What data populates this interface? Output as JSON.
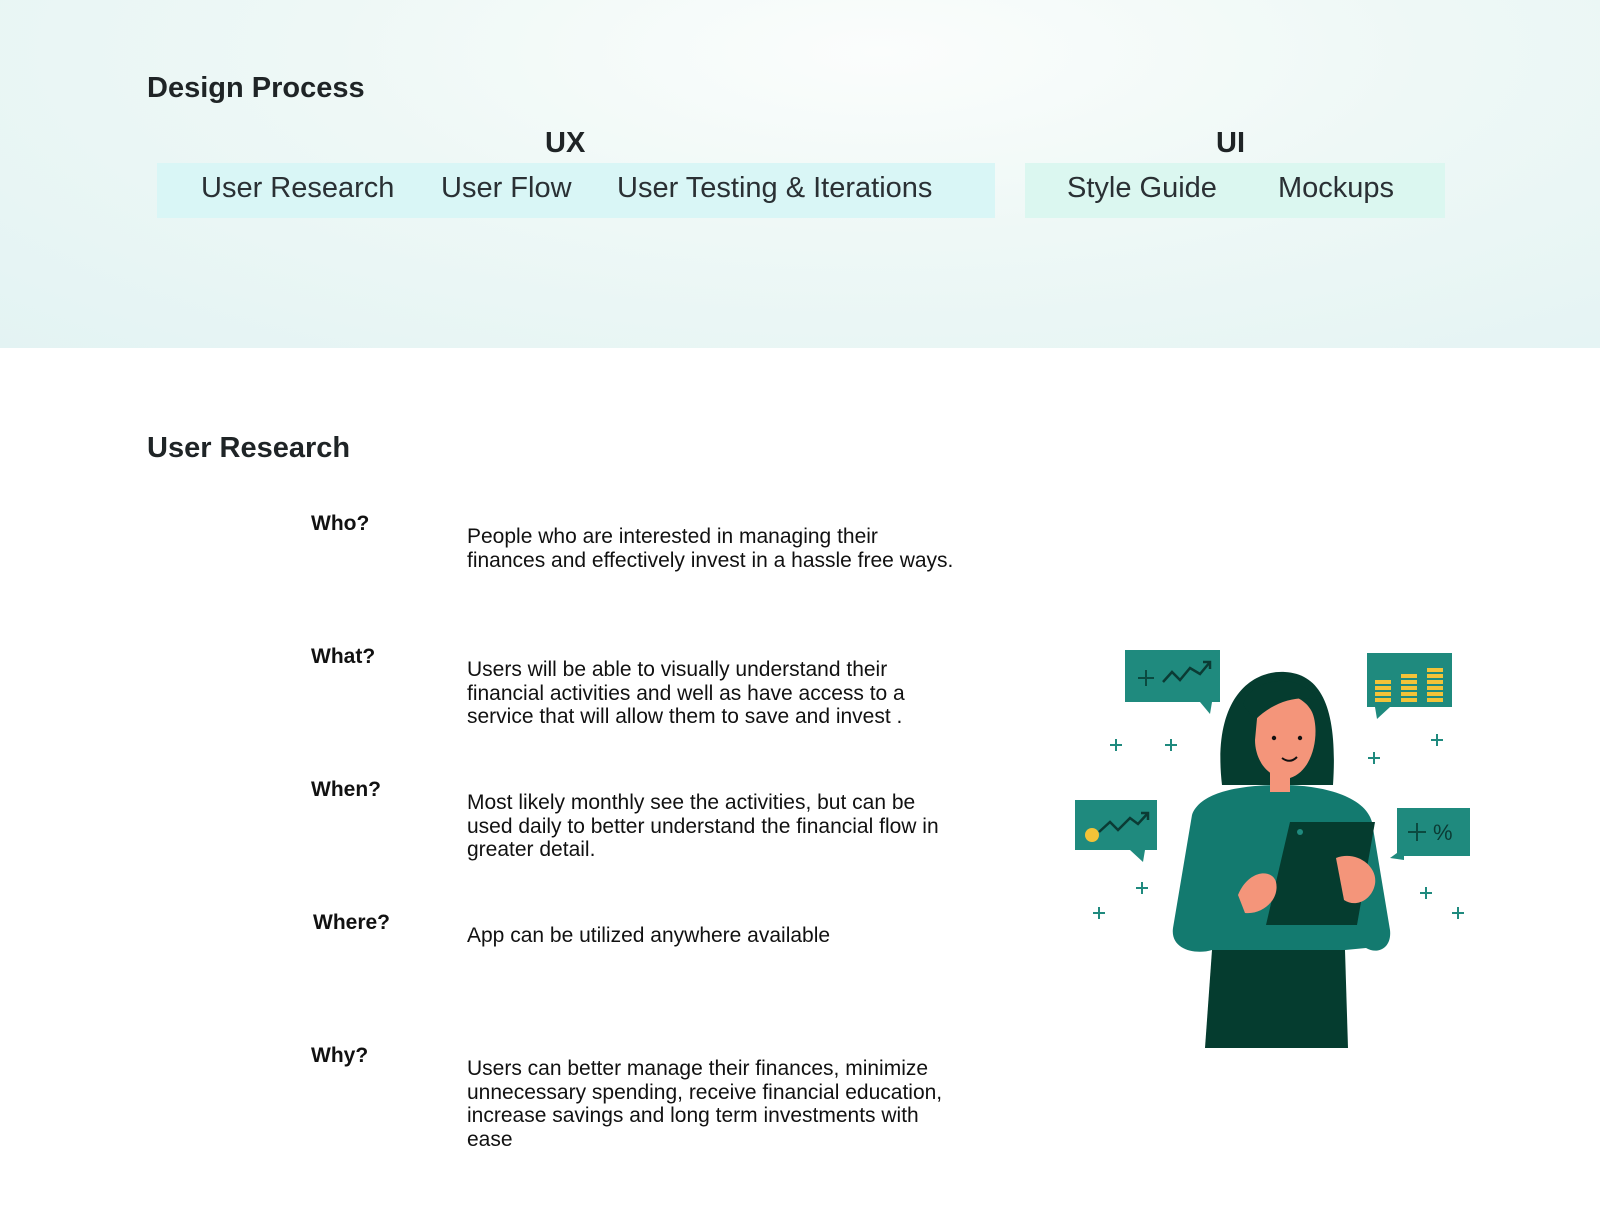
{
  "design_process": {
    "title": "Design Process",
    "ux": {
      "label": "UX",
      "steps": [
        "User Research",
        "User Flow",
        "User Testing & Iterations"
      ]
    },
    "ui": {
      "label": "UI",
      "steps": [
        "Style Guide",
        "Mockups"
      ]
    }
  },
  "user_research": {
    "title": "User Research",
    "questions": [
      {
        "q": "Who?",
        "a": "People who are interested in managing their finances and effectively invest in a hassle free ways."
      },
      {
        "q": "What?",
        "a": "Users will be able to visually understand their financial activities and well as have access to a service that will allow them to save and invest ."
      },
      {
        "q": "When?",
        "a": "Most likely monthly see the activities, but can be used daily to better understand the financial flow in greater detail."
      },
      {
        "q": "Where?",
        "a": "App can be utilized anywhere available"
      },
      {
        "q": "Why?",
        "a": "Users can better manage their finances, minimize unnecessary spending, receive financial education, increase savings and long term investments with ease"
      }
    ]
  },
  "colors": {
    "band_background": "#e8f6f4",
    "ux_bar": "#d9f6f6",
    "ui_bar": "#dbf7f0",
    "illustration_teal": "#137a6f",
    "illustration_dark": "#053c2f",
    "illustration_accent": "#f3c338",
    "skin": "#f4957a"
  },
  "icons": [
    "woman-with-tablet-illustration",
    "growth-chart-bubble-icon",
    "coin-stacks-bubble-icon",
    "trend-coin-bubble-icon",
    "percent-bubble-icon"
  ]
}
